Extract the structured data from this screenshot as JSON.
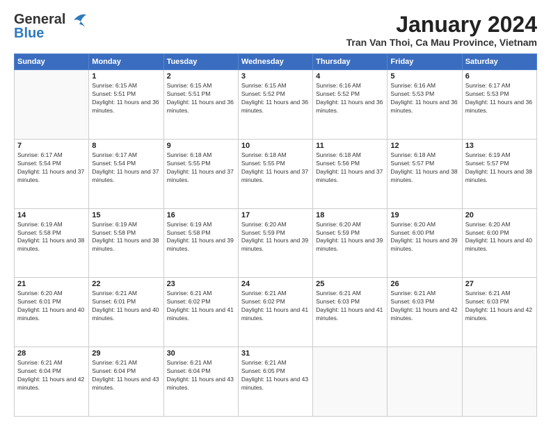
{
  "header": {
    "logo_general": "General",
    "logo_blue": "Blue",
    "month_title": "January 2024",
    "location": "Tran Van Thoi, Ca Mau Province, Vietnam"
  },
  "weekdays": [
    "Sunday",
    "Monday",
    "Tuesday",
    "Wednesday",
    "Thursday",
    "Friday",
    "Saturday"
  ],
  "weeks": [
    [
      {
        "day": "",
        "info": ""
      },
      {
        "day": "1",
        "info": "Sunrise: 6:15 AM\nSunset: 5:51 PM\nDaylight: 11 hours and 36 minutes."
      },
      {
        "day": "2",
        "info": "Sunrise: 6:15 AM\nSunset: 5:51 PM\nDaylight: 11 hours and 36 minutes."
      },
      {
        "day": "3",
        "info": "Sunrise: 6:15 AM\nSunset: 5:52 PM\nDaylight: 11 hours and 36 minutes."
      },
      {
        "day": "4",
        "info": "Sunrise: 6:16 AM\nSunset: 5:52 PM\nDaylight: 11 hours and 36 minutes."
      },
      {
        "day": "5",
        "info": "Sunrise: 6:16 AM\nSunset: 5:53 PM\nDaylight: 11 hours and 36 minutes."
      },
      {
        "day": "6",
        "info": "Sunrise: 6:17 AM\nSunset: 5:53 PM\nDaylight: 11 hours and 36 minutes."
      }
    ],
    [
      {
        "day": "7",
        "info": "Sunrise: 6:17 AM\nSunset: 5:54 PM\nDaylight: 11 hours and 37 minutes."
      },
      {
        "day": "8",
        "info": "Sunrise: 6:17 AM\nSunset: 5:54 PM\nDaylight: 11 hours and 37 minutes."
      },
      {
        "day": "9",
        "info": "Sunrise: 6:18 AM\nSunset: 5:55 PM\nDaylight: 11 hours and 37 minutes."
      },
      {
        "day": "10",
        "info": "Sunrise: 6:18 AM\nSunset: 5:55 PM\nDaylight: 11 hours and 37 minutes."
      },
      {
        "day": "11",
        "info": "Sunrise: 6:18 AM\nSunset: 5:56 PM\nDaylight: 11 hours and 37 minutes."
      },
      {
        "day": "12",
        "info": "Sunrise: 6:18 AM\nSunset: 5:57 PM\nDaylight: 11 hours and 38 minutes."
      },
      {
        "day": "13",
        "info": "Sunrise: 6:19 AM\nSunset: 5:57 PM\nDaylight: 11 hours and 38 minutes."
      }
    ],
    [
      {
        "day": "14",
        "info": "Sunrise: 6:19 AM\nSunset: 5:58 PM\nDaylight: 11 hours and 38 minutes."
      },
      {
        "day": "15",
        "info": "Sunrise: 6:19 AM\nSunset: 5:58 PM\nDaylight: 11 hours and 38 minutes."
      },
      {
        "day": "16",
        "info": "Sunrise: 6:19 AM\nSunset: 5:58 PM\nDaylight: 11 hours and 39 minutes."
      },
      {
        "day": "17",
        "info": "Sunrise: 6:20 AM\nSunset: 5:59 PM\nDaylight: 11 hours and 39 minutes."
      },
      {
        "day": "18",
        "info": "Sunrise: 6:20 AM\nSunset: 5:59 PM\nDaylight: 11 hours and 39 minutes."
      },
      {
        "day": "19",
        "info": "Sunrise: 6:20 AM\nSunset: 6:00 PM\nDaylight: 11 hours and 39 minutes."
      },
      {
        "day": "20",
        "info": "Sunrise: 6:20 AM\nSunset: 6:00 PM\nDaylight: 11 hours and 40 minutes."
      }
    ],
    [
      {
        "day": "21",
        "info": "Sunrise: 6:20 AM\nSunset: 6:01 PM\nDaylight: 11 hours and 40 minutes."
      },
      {
        "day": "22",
        "info": "Sunrise: 6:21 AM\nSunset: 6:01 PM\nDaylight: 11 hours and 40 minutes."
      },
      {
        "day": "23",
        "info": "Sunrise: 6:21 AM\nSunset: 6:02 PM\nDaylight: 11 hours and 41 minutes."
      },
      {
        "day": "24",
        "info": "Sunrise: 6:21 AM\nSunset: 6:02 PM\nDaylight: 11 hours and 41 minutes."
      },
      {
        "day": "25",
        "info": "Sunrise: 6:21 AM\nSunset: 6:03 PM\nDaylight: 11 hours and 41 minutes."
      },
      {
        "day": "26",
        "info": "Sunrise: 6:21 AM\nSunset: 6:03 PM\nDaylight: 11 hours and 42 minutes."
      },
      {
        "day": "27",
        "info": "Sunrise: 6:21 AM\nSunset: 6:03 PM\nDaylight: 11 hours and 42 minutes."
      }
    ],
    [
      {
        "day": "28",
        "info": "Sunrise: 6:21 AM\nSunset: 6:04 PM\nDaylight: 11 hours and 42 minutes."
      },
      {
        "day": "29",
        "info": "Sunrise: 6:21 AM\nSunset: 6:04 PM\nDaylight: 11 hours and 43 minutes."
      },
      {
        "day": "30",
        "info": "Sunrise: 6:21 AM\nSunset: 6:04 PM\nDaylight: 11 hours and 43 minutes."
      },
      {
        "day": "31",
        "info": "Sunrise: 6:21 AM\nSunset: 6:05 PM\nDaylight: 11 hours and 43 minutes."
      },
      {
        "day": "",
        "info": ""
      },
      {
        "day": "",
        "info": ""
      },
      {
        "day": "",
        "info": ""
      }
    ]
  ]
}
